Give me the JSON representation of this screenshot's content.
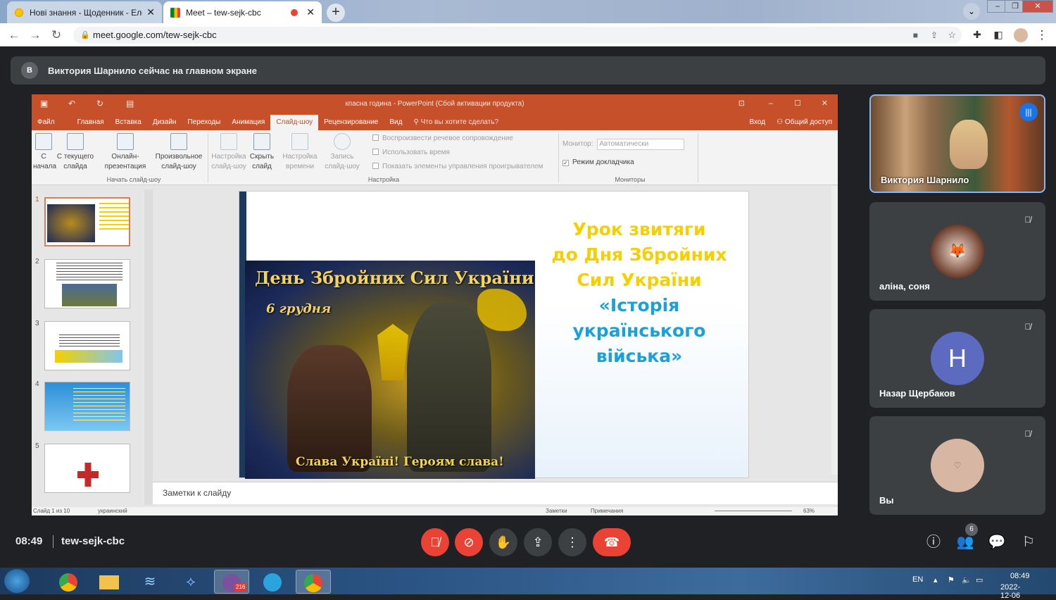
{
  "browser": {
    "tabs": [
      {
        "title": "Нові знання - Щоденник - Елек",
        "close": "✕"
      },
      {
        "title": "Meet – tew-sejk-cbc",
        "close": "✕"
      }
    ],
    "new_tab": "+",
    "url": "meet.google.com/tew-sejk-cbc"
  },
  "banner": {
    "avatar_letter": "В",
    "text": "Виктория Шарнило сейчас на главном экране"
  },
  "powerpoint": {
    "title": "кпасна година - PowerPoint (Сбой активации продукта)",
    "tabs": [
      "Файл",
      "Главная",
      "Вставка",
      "Дизайн",
      "Переходы",
      "Анимация",
      "Слайд-шоу",
      "Рецензирование",
      "Вид",
      "Что вы хотите сделать?"
    ],
    "signin": "Вход",
    "share": "Общий доступ",
    "ribbon": {
      "from_start": "С начала",
      "from_current": "С текущего слайда",
      "online": "Онлайн-презентация",
      "custom": "Произвольное слайд-шоу",
      "group_start": "Начать слайд-шоу",
      "setup": "Настройка слайд-шоу",
      "hide": "Скрыть слайд",
      "timing": "Настройка времени",
      "record": "Запись слайд-шоу",
      "opt1": "Воспроизвести речевое сопровождение",
      "opt2": "Использовать время",
      "opt3": "Показать элементы управления проигрывателем",
      "group_setup": "Настройка",
      "monitor_label": "Монитор:",
      "monitor_value": "Автоматически",
      "presenter": "Режим докладчика",
      "group_monitors": "Мониторы"
    },
    "slide_numbers": [
      "1",
      "2",
      "3",
      "4",
      "5"
    ],
    "poster_title": "День Збройних Сил України",
    "poster_date": "6 грудня",
    "poster_footer": "Слава Україні! Героям слава!",
    "slide_title_lines": [
      "Урок звитяги",
      "до Дня Збройних",
      "Сил України"
    ],
    "slide_title_blue_lines": [
      "«Історія",
      "українського",
      "війська»"
    ],
    "notes": "Заметки к слайду",
    "status_left": "Слайд 1 из 10",
    "status_lang": "украинский",
    "status_notes": "Заметки",
    "status_comments": "Примечания",
    "zoom": "63%"
  },
  "participants": [
    {
      "name": "Виктория Шарнило"
    },
    {
      "name": "аліна, соня"
    },
    {
      "name": "Назар Щербаков",
      "avatar_letter": "Н",
      "color": "#5c6bc0"
    },
    {
      "name": "Вы",
      "avatar_letter": "♡",
      "color": "#d7b6a3"
    }
  ],
  "controls": {
    "time": "08:49",
    "meeting_code": "tew-sejk-cbc",
    "people_count": "6"
  },
  "taskbar": {
    "lang": "EN",
    "time": "08:49",
    "date": "2022-12-06",
    "viber_badge": "216"
  }
}
